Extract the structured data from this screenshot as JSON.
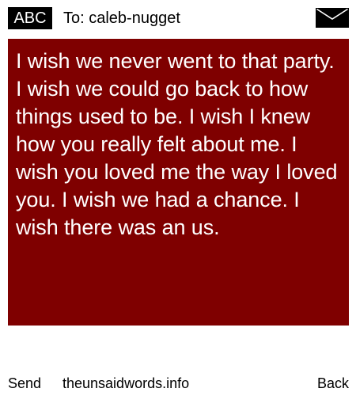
{
  "header": {
    "input_mode_label": "ABC",
    "recipient_line": "To: caleb-nugget",
    "envelope_icon": "envelope-icon"
  },
  "message": {
    "text": "I wish we never went to that party. I wish we could go back to how things used to be. I wish I knew how you really felt about me. I wish you loved me the way I loved you. I wish we had a chance. I wish there was an us.",
    "background_color": "#7f0000",
    "text_color": "#ffffff"
  },
  "footer": {
    "send_label": "Send",
    "site_label": "theunsaidwords.info",
    "back_label": "Back"
  }
}
